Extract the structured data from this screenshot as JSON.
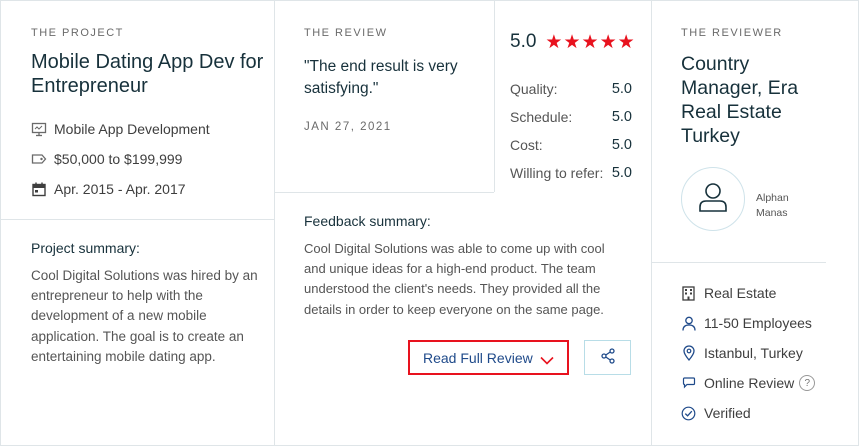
{
  "project": {
    "eyebrow": "THE PROJECT",
    "title": "Mobile Dating App Dev for Entrepreneur",
    "service": "Mobile App Development",
    "budget": "$50,000 to $199,999",
    "dates": "Apr. 2015 - Apr. 2017",
    "summary_label": "Project summary:",
    "summary": "Cool Digital Solutions was hired by an entrepreneur to help with the development of a new mobile application. The goal is to create an entertaining mobile dating app."
  },
  "review": {
    "eyebrow": "THE REVIEW",
    "quote": "\"The end result is very satisfying.\"",
    "date": "JAN 27, 2021",
    "overall": "5.0",
    "stars": 5,
    "star_color": "#e8121e",
    "ratings": [
      {
        "label": "Quality:",
        "value": "5.0"
      },
      {
        "label": "Schedule:",
        "value": "5.0"
      },
      {
        "label": "Cost:",
        "value": "5.0"
      },
      {
        "label": "Willing to refer:",
        "value": "5.0"
      }
    ],
    "feedback_label": "Feedback summary:",
    "feedback": "Cool Digital Solutions was able to come up with cool and unique ideas for a high-end product. The team understood the client's needs. They provided all the details in order to keep everyone on the same page.",
    "read_button": "Read Full Review",
    "share_icon": "share-icon"
  },
  "reviewer": {
    "eyebrow": "THE REVIEWER",
    "title": "Country Manager, Era Real Estate Turkey",
    "name": "Alphan Manas",
    "industry": "Real Estate",
    "employees": "11-50 Employees",
    "location": "Istanbul, Turkey",
    "review_type": "Online Review",
    "help_mark": "?",
    "verified": "Verified"
  }
}
